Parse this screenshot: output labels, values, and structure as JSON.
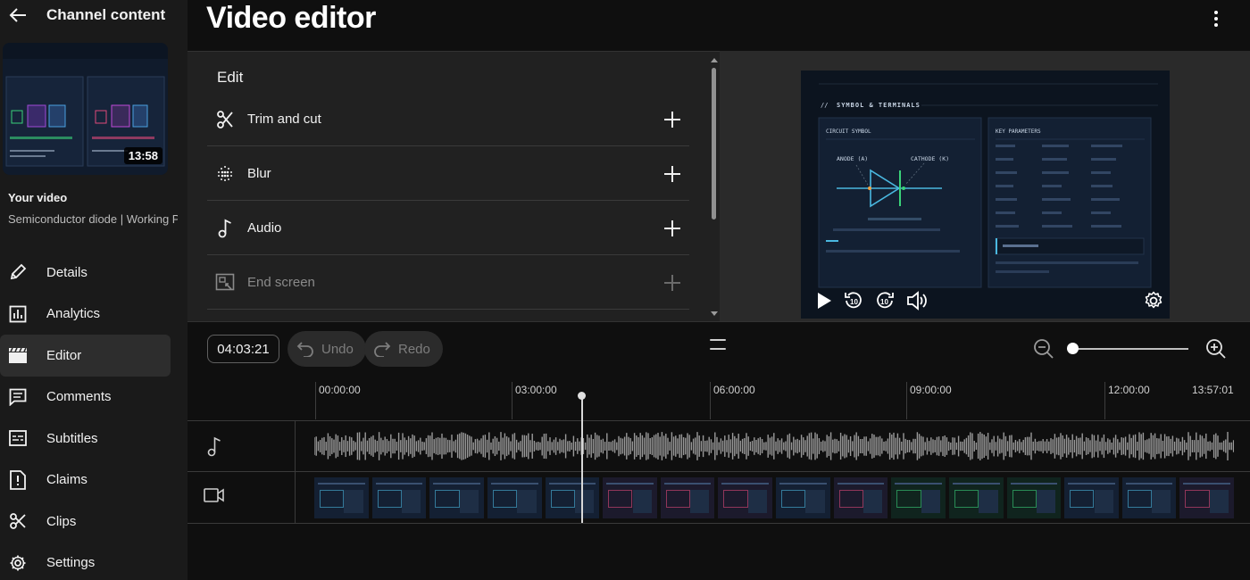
{
  "sidebar": {
    "title": "Channel content",
    "thumbnail_duration": "13:58",
    "your_video_label": "Your video",
    "video_title": "Semiconductor diode | Working Pr...",
    "nav": [
      {
        "label": "Details",
        "icon": "pencil-icon"
      },
      {
        "label": "Analytics",
        "icon": "bar-chart-icon"
      },
      {
        "label": "Editor",
        "icon": "clapperboard-icon",
        "active": true
      },
      {
        "label": "Comments",
        "icon": "comment-icon"
      },
      {
        "label": "Subtitles",
        "icon": "subtitles-icon"
      },
      {
        "label": "Claims",
        "icon": "claims-icon"
      },
      {
        "label": "Clips",
        "icon": "scissors-icon"
      },
      {
        "label": "Settings",
        "icon": "gear-icon"
      }
    ]
  },
  "header": {
    "title": "Video editor"
  },
  "edit_panel": {
    "heading": "Edit",
    "items": [
      {
        "label": "Trim and cut",
        "icon": "scissors-icon",
        "enabled": true
      },
      {
        "label": "Blur",
        "icon": "blur-icon",
        "enabled": true
      },
      {
        "label": "Audio",
        "icon": "music-note-icon",
        "enabled": true
      },
      {
        "label": "End screen",
        "icon": "end-screen-icon",
        "enabled": false
      }
    ]
  },
  "preview": {
    "slide": {
      "heading": "SYMBOL & TERMINALS",
      "left_panel_title": "CIRCUIT SYMBOL",
      "anode_label": "ANODE (A)",
      "cathode_label": "CATHODE (K)",
      "right_panel_title": "KEY PARAMETERS"
    }
  },
  "timeline": {
    "timecode": "04:03:21",
    "undo_label": "Undo",
    "redo_label": "Redo",
    "ruler": [
      "00:00:00",
      "03:00:00",
      "06:00:00",
      "09:00:00",
      "12:00:00",
      "13:57:01"
    ]
  }
}
